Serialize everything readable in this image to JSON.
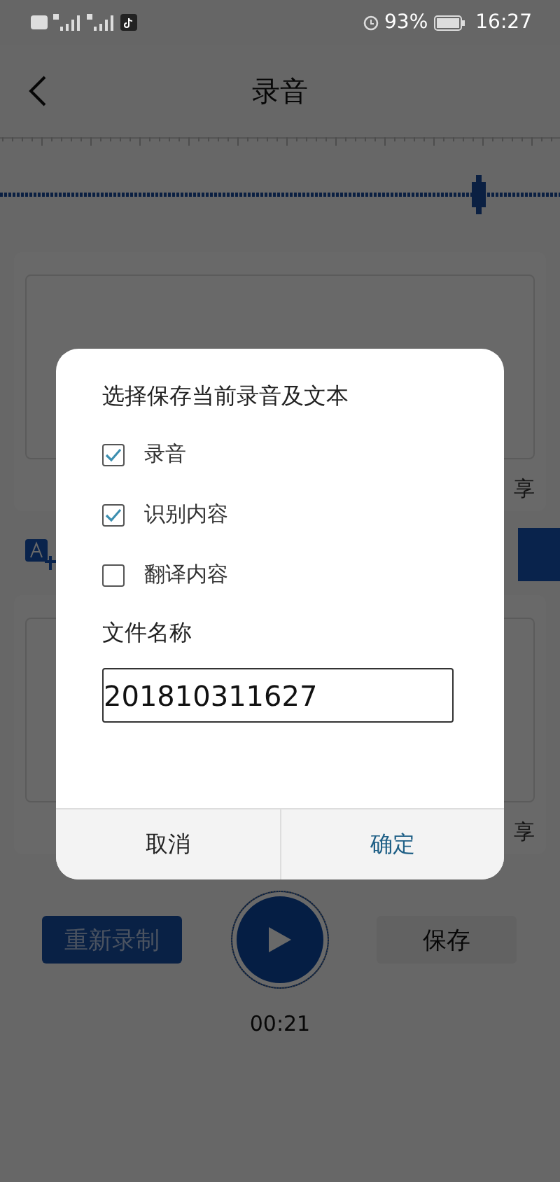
{
  "status_bar": {
    "battery": "93%",
    "time": "16:27"
  },
  "header": {
    "title": "录音"
  },
  "cards": [
    {
      "share_label": "享"
    },
    {
      "share_label": "享"
    }
  ],
  "controls": {
    "rerecord": "重新录制",
    "save": "保存",
    "timer": "00:21"
  },
  "dialog": {
    "title": "选择保存当前录音及文本",
    "options": [
      {
        "label": "录音",
        "checked": true
      },
      {
        "label": "识别内容",
        "checked": true
      },
      {
        "label": "翻译内容",
        "checked": false
      }
    ],
    "filename_label": "文件名称",
    "filename": "201810311627",
    "buttons": [
      {
        "label": "取消",
        "kind": "cancel"
      },
      {
        "label": "确定",
        "kind": "confirm"
      }
    ]
  }
}
